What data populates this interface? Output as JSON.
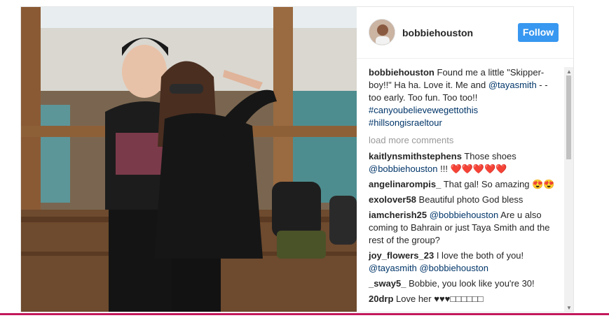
{
  "post": {
    "header": {
      "username": "bobbiehouston",
      "follow_label": "Follow"
    },
    "caption": {
      "username": "bobbiehouston",
      "text": "Found me a little \"Skipper-boy!!\" Ha ha. Love it. Me and",
      "mention": "@tayasmith",
      "text2": " - - too early. Too fun. Too too!!",
      "hashtags": [
        "#canyoubelievewegettothis",
        "#hillsongisraeltour"
      ]
    },
    "load_more": "load more comments",
    "comments": [
      {
        "user": "kaitlynsmithstephens",
        "text": " Those shoes ",
        "mention": "@bobbiehouston",
        "tail": " !!! ❤️❤️❤️❤️❤️"
      },
      {
        "user": "angelinarompis_",
        "text": " That gal! So amazing 😍😍",
        "mention": "",
        "tail": ""
      },
      {
        "user": "exolover58",
        "text": " Beautiful photo God bless",
        "mention": "",
        "tail": ""
      },
      {
        "user": "iamcherish25",
        "text": " ",
        "mention": "@bobbiehouston",
        "tail": " Are u also coming to Bahrain or just Taya Smith and the rest of the group?"
      },
      {
        "user": "joy_flowers_23",
        "text": " I love the both of you! ",
        "mention": "@tayasmith @bobbiehouston",
        "tail": ""
      },
      {
        "user": "_sway5_",
        "text": " Bobbie, you look like you're 30!",
        "mention": "",
        "tail": ""
      },
      {
        "user": "20drp",
        "text": " Love her ♥♥♥□□□□□□",
        "mention": "",
        "tail": ""
      }
    ]
  },
  "icons": {
    "scroll_up": "triangle-up-icon",
    "scroll_down": "triangle-down-icon"
  },
  "colors": {
    "follow": "#3897f0",
    "link": "#003569",
    "accent_line": "#c2185b"
  }
}
